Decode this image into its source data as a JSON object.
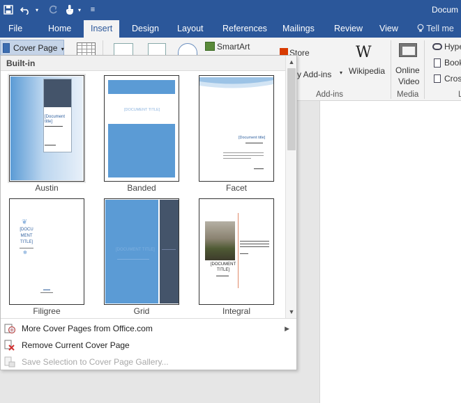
{
  "title_bar": {
    "document_title": "Docum",
    "qat": [
      "save-icon",
      "undo-icon",
      "redo-icon",
      "touch-mode-icon",
      "customize-qat-icon"
    ]
  },
  "tabs": [
    {
      "label": "File"
    },
    {
      "label": "Home"
    },
    {
      "label": "Insert",
      "active": true
    },
    {
      "label": "Design"
    },
    {
      "label": "Layout"
    },
    {
      "label": "References"
    },
    {
      "label": "Mailings"
    },
    {
      "label": "Review"
    },
    {
      "label": "View"
    }
  ],
  "tell_me": "Tell me",
  "ribbon": {
    "cover_page_label": "Cover Page",
    "smartart_label": "SmartArt",
    "store_label": "Store",
    "my_addins_label": "y Add-ins",
    "wikipedia_label": "Wikipedia",
    "online_video_line1": "Online",
    "online_video_line2": "Video",
    "hyperlink_label": "Hype",
    "bookmark_label": "Book",
    "crossref_label": "Cros",
    "group_addins": "Add-ins",
    "group_media": "Media",
    "group_links": "L"
  },
  "gallery": {
    "section_header": "Built-in",
    "templates": [
      {
        "name": "Austin",
        "title_text": "[Document title]"
      },
      {
        "name": "Banded",
        "title_text": "[DOCUMENT TITLE]"
      },
      {
        "name": "Facet",
        "title_text": "[Document title]"
      },
      {
        "name": "Filigree",
        "title_text": "[DOCU MENT TITLE]"
      },
      {
        "name": "Grid",
        "title_text": "[DOCUMENT TITLE]"
      },
      {
        "name": "Integral",
        "title_text": "[DOCUMENT TITLE]"
      }
    ],
    "menu": [
      {
        "label": "More Cover Pages from Office.com",
        "icon": "office-com-icon",
        "has_submenu": true,
        "enabled": true
      },
      {
        "label": "Remove Current Cover Page",
        "icon": "remove-cover-page-icon",
        "has_submenu": false,
        "enabled": true
      },
      {
        "label": "Save Selection to Cover Page Gallery...",
        "icon": "save-to-gallery-icon",
        "has_submenu": false,
        "enabled": false
      }
    ]
  },
  "colors": {
    "ribbon_blue": "#2b579a",
    "template_blue": "#5b9bd5",
    "grid_dark": "#44546a"
  }
}
